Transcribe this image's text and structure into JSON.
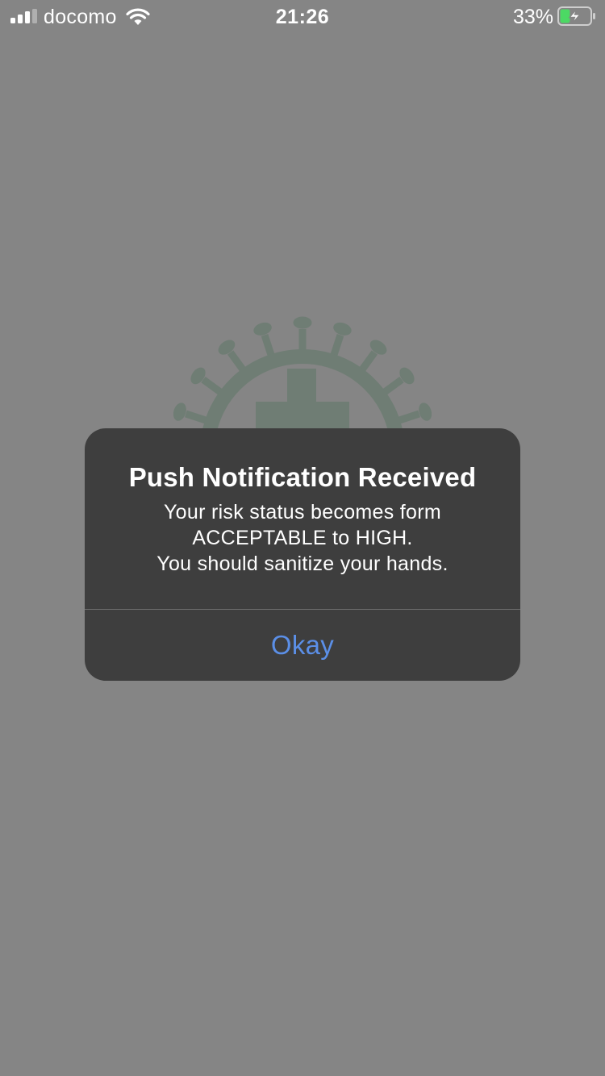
{
  "status_bar": {
    "carrier": "docomo",
    "time": "21:26",
    "battery_percent_label": "33%",
    "battery_level": 0.33,
    "battery_charging": true,
    "signal_bars": 3,
    "icons": [
      "signal-bars-icon",
      "wifi-icon",
      "battery-charging-icon"
    ]
  },
  "background": {
    "logo_icon": "virus-medical-cross-icon"
  },
  "alert": {
    "title": "Push Notification Received",
    "message_lines": [
      "Your risk status becomes form",
      "ACCEPTABLE to HIGH.",
      "You should sanitize your hands."
    ],
    "button_label": "Okay"
  },
  "colors": {
    "dim_background": "#858585",
    "alert_background": "#3e3e3e",
    "button_text": "#5b8fe7",
    "battery_fill": "#4cd964",
    "logo": "#6f7d74"
  }
}
